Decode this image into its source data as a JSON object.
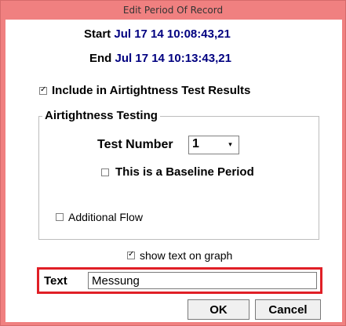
{
  "window": {
    "title": "Edit Period Of Record",
    "frame_color": "#f08080"
  },
  "period": {
    "start_label": "Start",
    "start_value": "Jul 17 14 10:08:43,21",
    "end_label": "End",
    "end_value": "Jul 17 14 10:13:43,21",
    "value_color": "#000080"
  },
  "include_results": {
    "label": "Include in Airtightness Test Results",
    "checked": true
  },
  "airtightness_group": {
    "title": "Airtightness Testing",
    "test_number_label": "Test Number",
    "test_number_value": "1",
    "baseline": {
      "label": "This is a Baseline Period",
      "checked": false
    },
    "additional_flow": {
      "label": "Additional Flow",
      "checked": false
    }
  },
  "show_text_on_graph": {
    "label": "show text on graph",
    "checked": true
  },
  "text_field": {
    "label": "Text",
    "value": "Messung",
    "highlight_color": "#e01f26"
  },
  "buttons": {
    "ok_label": "OK",
    "cancel_label": "Cancel"
  }
}
